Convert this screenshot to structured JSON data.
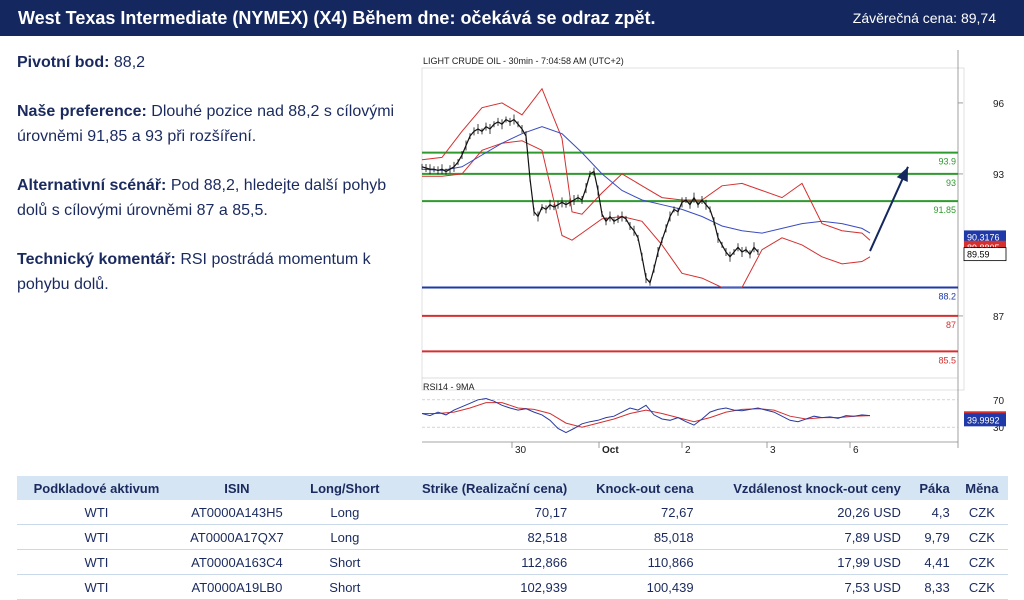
{
  "header": {
    "title": "West Texas Intermediate (NYMEX) (X4) Během dne: očekává se odraz zpět.",
    "close_label": "Závěrečná cena:",
    "close_value": "89,74"
  },
  "analysis": {
    "pivot_label": "Pivotní bod:",
    "pivot_text": "88,2",
    "pref_label": "Naše preference:",
    "pref_text": "Dlouhé pozice nad 88,2 s cílovými úrovněmi 91,85 a 93 při  rozšíření.",
    "alt_label": "Alternativní scénář:",
    "alt_text": "Pod 88,2, hledejte další pohyb dolů s cílovými úrovněmi 87 a 85,5.",
    "tech_label": "Technický komentář:",
    "tech_text": "RSI postrádá momentum k pohybu dolů."
  },
  "chart_data": {
    "type": "line",
    "title": "LIGHT CRUDE OIL - 30min - 7:04:58 AM (UTC+2)",
    "ylim": [
      84.8,
      96.8
    ],
    "y_ticks": [
      "96",
      "93",
      "87"
    ],
    "x_ticks": [
      "30",
      "Oct",
      "2",
      "3",
      "6"
    ],
    "price_series": {
      "name": "LIGHT CRUDE OIL",
      "x": [
        0,
        4,
        8,
        12,
        16,
        20,
        24,
        28,
        32,
        36,
        40,
        44,
        48,
        52,
        56,
        60,
        64,
        68,
        72,
        76,
        80,
        84,
        88,
        92,
        96,
        100,
        104,
        108,
        112,
        116,
        120,
        124,
        128,
        132,
        136,
        140,
        144,
        148,
        152,
        156,
        160,
        164,
        168,
        172,
        176,
        180,
        184,
        188,
        192,
        196,
        200,
        204,
        208,
        212,
        216,
        220,
        224,
        228,
        232,
        236,
        240,
        244,
        248,
        252,
        256,
        260,
        264,
        268,
        272,
        276,
        280,
        284,
        288,
        292,
        296,
        300,
        304,
        308,
        312,
        316,
        320,
        324,
        328,
        332,
        336,
        340,
        344,
        348,
        352,
        356,
        360,
        364,
        368,
        372,
        376,
        380,
        384,
        388,
        392,
        396,
        400,
        404,
        408,
        412,
        416,
        420,
        424,
        428,
        432,
        436,
        440,
        444,
        448
      ],
      "y": [
        93.3,
        93.25,
        93.2,
        93.2,
        93.15,
        93.2,
        93.1,
        93.2,
        93.3,
        93.5,
        93.8,
        94.2,
        94.6,
        94.8,
        94.9,
        94.8,
        95.0,
        94.9,
        95.1,
        95.2,
        95.1,
        95.3,
        95.2,
        95.3,
        95.1,
        94.9,
        94.6,
        92.8,
        91.4,
        91.2,
        91.6,
        91.5,
        91.7,
        91.6,
        91.7,
        91.8,
        91.7,
        91.8,
        91.9,
        92.0,
        91.9,
        92.4,
        93.0,
        93.1,
        92.3,
        91.3,
        91.0,
        91.2,
        91.0,
        91.1,
        91.2,
        91.1,
        90.8,
        90.6,
        90.3,
        89.5,
        88.6,
        88.4,
        89.0,
        89.7,
        90.2,
        90.7,
        91.2,
        91.5,
        91.4,
        91.8,
        91.9,
        91.7,
        92.0,
        91.7,
        91.9,
        91.7,
        91.5,
        91.0,
        90.3,
        90.0,
        89.7,
        89.5,
        89.7,
        89.9,
        89.7,
        89.8,
        89.6,
        89.9,
        89.7
      ]
    },
    "bollinger_upper": {
      "x": [
        0,
        20,
        40,
        60,
        80,
        100,
        120,
        140,
        150,
        160,
        180,
        200,
        220,
        240,
        260,
        280,
        300,
        320,
        340,
        360,
        380,
        400,
        420,
        440,
        448
      ],
      "y": [
        93.6,
        93.7,
        94.8,
        95.8,
        96.0,
        95.5,
        96.6,
        94.5,
        91.4,
        91.3,
        92.2,
        93.0,
        92.5,
        92.0,
        91.9,
        91.9,
        92.5,
        92.6,
        92.3,
        92.0,
        92.6,
        90.9,
        90.6,
        90.5,
        90.2
      ]
    },
    "bollinger_lower": {
      "x": [
        0,
        20,
        40,
        60,
        80,
        100,
        120,
        140,
        150,
        160,
        180,
        200,
        220,
        240,
        260,
        280,
        300,
        320,
        340,
        360,
        380,
        400,
        420,
        440,
        448
      ],
      "y": [
        92.9,
        92.9,
        93.0,
        94.0,
        94.3,
        94.4,
        94.0,
        90.4,
        90.2,
        90.5,
        91.1,
        91.2,
        91.0,
        90.0,
        88.8,
        88.6,
        88.2,
        88.2,
        89.8,
        90.3,
        90.0,
        89.5,
        89.2,
        89.3,
        89.5
      ]
    },
    "moving_average": {
      "x": [
        0,
        20,
        40,
        60,
        80,
        100,
        120,
        140,
        160,
        180,
        200,
        220,
        240,
        260,
        280,
        300,
        320,
        340,
        360,
        380,
        400,
        420,
        440,
        448
      ],
      "y": [
        93.2,
        93.15,
        93.3,
        93.8,
        94.3,
        94.7,
        95.0,
        94.7,
        93.9,
        93.0,
        92.3,
        91.9,
        91.7,
        91.5,
        91.2,
        90.8,
        90.6,
        90.5,
        90.7,
        90.9,
        91.0,
        90.9,
        90.7,
        90.5
      ]
    },
    "levels": [
      {
        "value": 93.9,
        "label": "93.9",
        "color": "#2e9a2e"
      },
      {
        "value": 93.0,
        "label": "93",
        "color": "#2e9a2e"
      },
      {
        "value": 91.85,
        "label": "91.85",
        "color": "#2e9a2e"
      },
      {
        "value": 88.2,
        "label": "88.2",
        "color": "#1f3aa8"
      },
      {
        "value": 87.0,
        "label": "87",
        "color": "#d43030"
      },
      {
        "value": 85.5,
        "label": "85.5",
        "color": "#d43030"
      }
    ],
    "projection": {
      "x": [
        448,
        486
      ],
      "y": [
        89.74,
        93.3
      ]
    },
    "price_labels": [
      {
        "value": 90.3176,
        "label": "90.3176",
        "color": "#1f3aa8"
      },
      {
        "value": 89.8805,
        "label": "89.8805",
        "color": "#d43030"
      },
      {
        "value": 89.59,
        "label": "89.59",
        "color": "#000000"
      }
    ],
    "rsi": {
      "title": "RSI14 - 9MA",
      "ylim": [
        20,
        80
      ],
      "y_ticks": [
        "70",
        "30"
      ],
      "x": [
        0,
        8,
        16,
        24,
        32,
        40,
        48,
        56,
        64,
        72,
        80,
        88,
        96,
        104,
        112,
        120,
        128,
        136,
        144,
        152,
        160,
        168,
        176,
        184,
        192,
        200,
        208,
        216,
        224,
        232,
        240,
        248,
        256,
        264,
        272,
        280,
        288,
        296,
        304,
        312,
        320,
        328,
        336,
        344,
        352,
        360,
        368,
        376,
        384,
        392,
        400,
        408,
        416,
        424,
        432,
        440,
        448
      ],
      "y": [
        50,
        47,
        52,
        48,
        55,
        60,
        65,
        70,
        72,
        68,
        62,
        58,
        55,
        57,
        52,
        48,
        40,
        28,
        22,
        28,
        35,
        38,
        40,
        44,
        46,
        52,
        58,
        55,
        62,
        48,
        42,
        40,
        44,
        38,
        33,
        42,
        52,
        56,
        58,
        55,
        54,
        56,
        58,
        55,
        52,
        46,
        40,
        38,
        42,
        46,
        44,
        45,
        43,
        47,
        46,
        48,
        47
      ],
      "ma_x": [
        0,
        16,
        32,
        48,
        64,
        80,
        96,
        112,
        128,
        144,
        160,
        176,
        192,
        208,
        224,
        240,
        256,
        272,
        288,
        304,
        320,
        336,
        352,
        368,
        384,
        400,
        416,
        432,
        448
      ],
      "ma_y": [
        50,
        50,
        52,
        58,
        66,
        66,
        58,
        56,
        50,
        36,
        30,
        36,
        42,
        50,
        55,
        50,
        44,
        38,
        44,
        52,
        56,
        57,
        55,
        46,
        42,
        44,
        44,
        46,
        47
      ],
      "price_labels": [
        {
          "value": 42.9805,
          "label": "42.9805",
          "color": "#d43030"
        },
        {
          "value": 39.9992,
          "label": "39.9992",
          "color": "#1f3aa8"
        }
      ]
    }
  },
  "products": {
    "headers": [
      "Podkladové aktivum",
      "ISIN",
      "Long/Short",
      "Strike (Realizační cena)",
      "Knock-out cena",
      "Vzdálenost knock-out ceny",
      "Páka",
      "Měna"
    ],
    "rows": [
      [
        "WTI",
        "AT0000A143H5",
        "Long",
        "70,17",
        "72,67",
        "20,26 USD",
        "4,3",
        "CZK"
      ],
      [
        "WTI",
        "AT0000A17QX7",
        "Long",
        "82,518",
        "85,018",
        "7,89 USD",
        "9,79",
        "CZK"
      ],
      [
        "WTI",
        "AT0000A163C4",
        "Short",
        "112,866",
        "110,866",
        "17,99 USD",
        "4,41",
        "CZK"
      ],
      [
        "WTI",
        "AT0000A19LB0",
        "Short",
        "102,939",
        "100,439",
        "7,53 USD",
        "8,33",
        "CZK"
      ]
    ]
  }
}
